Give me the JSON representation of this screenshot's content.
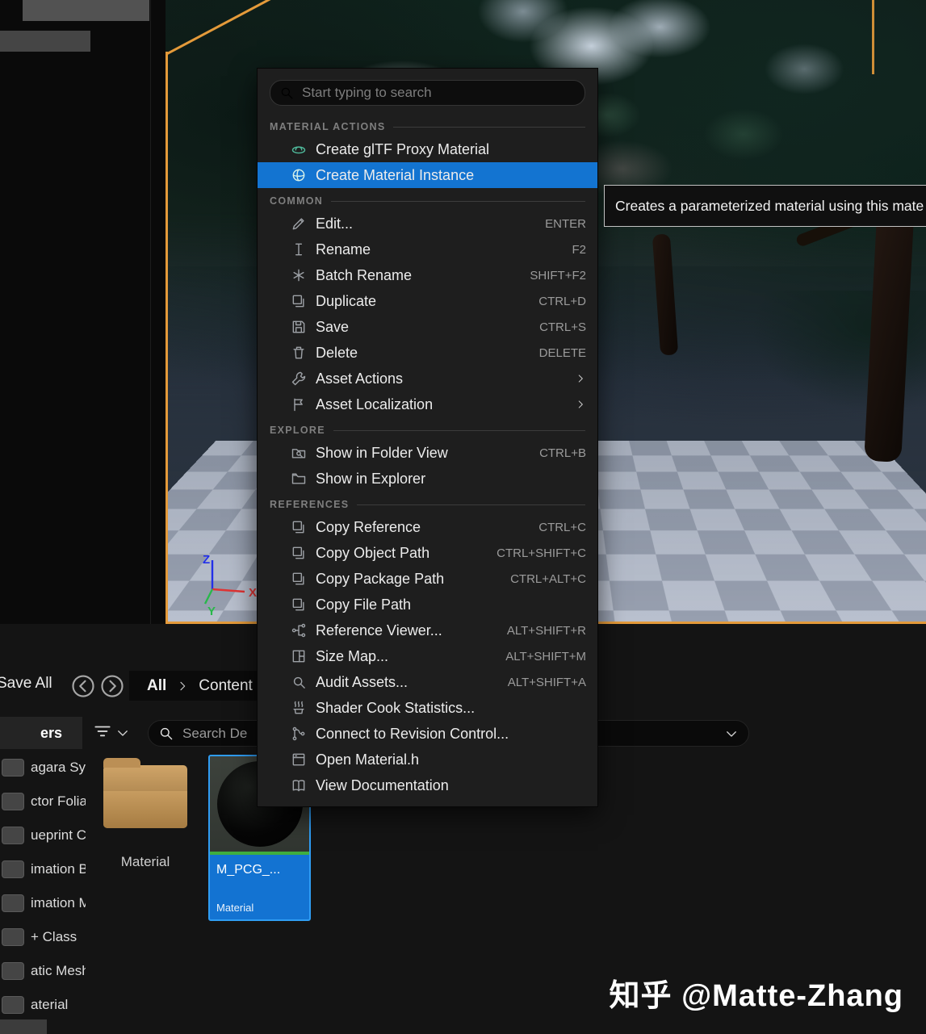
{
  "colors": {
    "selection_blue": "#1374d1",
    "outline_orange": "#e49a3a",
    "asset_type_green": "#3fae3f",
    "folder_tan": "#c49a5f"
  },
  "viewport": {
    "axis_labels": {
      "x": "X",
      "y": "Y",
      "z": "Z"
    }
  },
  "tooltip": {
    "text": "Creates a parameterized material using this mate"
  },
  "context_menu": {
    "search_placeholder": "Start typing to search",
    "sections": [
      {
        "header": "MATERIAL ACTIONS",
        "items": [
          {
            "label": "Create glTF Proxy Material",
            "icon": "gltf-icon",
            "shortcut": "",
            "submenu": false,
            "selected": false
          },
          {
            "label": "Create Material Instance",
            "icon": "material-sphere-icon",
            "shortcut": "",
            "submenu": false,
            "selected": true
          }
        ]
      },
      {
        "header": "COMMON",
        "items": [
          {
            "label": "Edit...",
            "icon": "pencil-icon",
            "shortcut": "ENTER",
            "submenu": false
          },
          {
            "label": "Rename",
            "icon": "text-cursor-icon",
            "shortcut": "F2",
            "submenu": false
          },
          {
            "label": "Batch Rename",
            "icon": "asterisk-icon",
            "shortcut": "SHIFT+F2",
            "submenu": false
          },
          {
            "label": "Duplicate",
            "icon": "duplicate-icon",
            "shortcut": "CTRL+D",
            "submenu": false
          },
          {
            "label": "Save",
            "icon": "save-icon",
            "shortcut": "CTRL+S",
            "submenu": false
          },
          {
            "label": "Delete",
            "icon": "trash-icon",
            "shortcut": "DELETE",
            "submenu": false
          },
          {
            "label": "Asset Actions",
            "icon": "wrench-icon",
            "shortcut": "",
            "submenu": true
          },
          {
            "label": "Asset Localization",
            "icon": "flag-icon",
            "shortcut": "",
            "submenu": true
          }
        ]
      },
      {
        "header": "EXPLORE",
        "items": [
          {
            "label": "Show in Folder View",
            "icon": "folder-view-icon",
            "shortcut": "CTRL+B",
            "submenu": false
          },
          {
            "label": "Show in Explorer",
            "icon": "folder-explorer-icon",
            "shortcut": "",
            "submenu": false
          }
        ]
      },
      {
        "header": "REFERENCES",
        "items": [
          {
            "label": "Copy Reference",
            "icon": "copy-icon",
            "shortcut": "CTRL+C",
            "submenu": false
          },
          {
            "label": "Copy Object Path",
            "icon": "copy-icon",
            "shortcut": "CTRL+SHIFT+C",
            "submenu": false
          },
          {
            "label": "Copy Package Path",
            "icon": "copy-icon",
            "shortcut": "CTRL+ALT+C",
            "submenu": false
          },
          {
            "label": "Copy File Path",
            "icon": "copy-icon",
            "shortcut": "",
            "submenu": false
          },
          {
            "label": "Reference Viewer...",
            "icon": "reference-graph-icon",
            "shortcut": "ALT+SHIFT+R",
            "submenu": false
          },
          {
            "label": "Size Map...",
            "icon": "size-map-icon",
            "shortcut": "ALT+SHIFT+M",
            "submenu": false
          },
          {
            "label": "Audit Assets...",
            "icon": "magnifier-icon",
            "shortcut": "ALT+SHIFT+A",
            "submenu": false
          },
          {
            "label": "Shader Cook Statistics...",
            "icon": "steam-icon",
            "shortcut": "",
            "submenu": false
          },
          {
            "label": "Connect to Revision Control...",
            "icon": "branch-icon",
            "shortcut": "",
            "submenu": false
          },
          {
            "label": "Open Material.h",
            "icon": "file-icon",
            "shortcut": "",
            "submenu": false
          },
          {
            "label": "View Documentation",
            "icon": "book-icon",
            "shortcut": "",
            "submenu": false
          }
        ]
      }
    ]
  },
  "toolbar": {
    "save_all_label": "Save All",
    "breadcrumb": {
      "root": "All",
      "current": "Content"
    }
  },
  "search": {
    "placeholder": "Search De"
  },
  "filter_panel": {
    "header": "ers",
    "items": [
      "agara Sys",
      "ctor Foliag",
      "ueprint Cla",
      "imation B",
      "imation M",
      "+ Class",
      "atic Mesh",
      "aterial"
    ]
  },
  "assets": {
    "folder": {
      "name": "Material"
    },
    "material": {
      "name": "M_PCG_...",
      "type": "Material"
    }
  },
  "watermark": "知乎 @Matte-Zhang"
}
